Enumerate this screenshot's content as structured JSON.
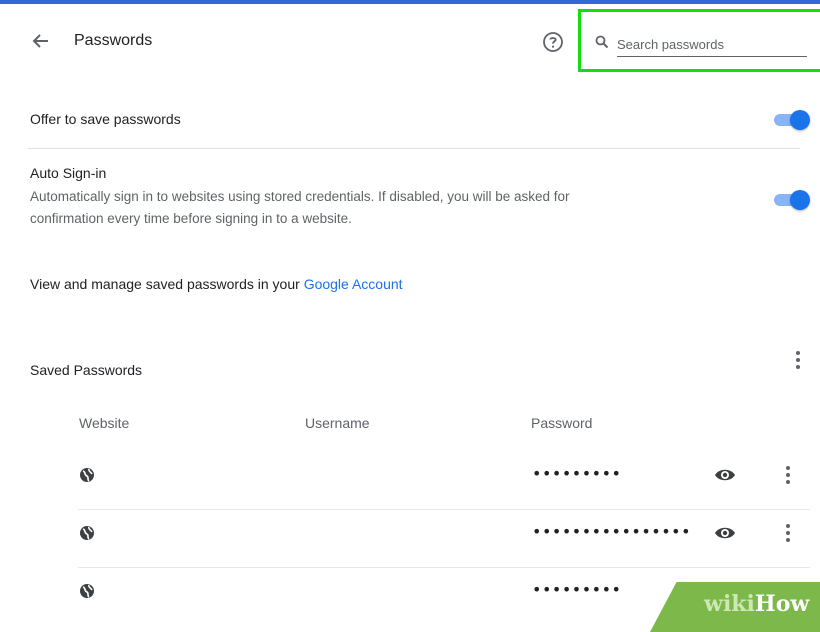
{
  "header": {
    "title": "Passwords",
    "search_placeholder": "Search passwords",
    "search_value": ""
  },
  "settings": {
    "offer_to_save": {
      "label": "Offer to save passwords",
      "enabled": true
    },
    "auto_signin": {
      "label": "Auto Sign-in",
      "description_line1": "Automatically sign in to websites using stored credentials. If disabled, you will be asked for",
      "description_line2": "confirmation every time before signing in to a website.",
      "enabled": true
    },
    "manage_text": "View and manage saved passwords in your ",
    "manage_link": "Google Account"
  },
  "saved_passwords": {
    "heading": "Saved Passwords",
    "columns": [
      "Website",
      "Username",
      "Password"
    ],
    "rows": [
      {
        "website": "",
        "username": "",
        "password_mask": "•••••••••"
      },
      {
        "website": "",
        "username": "",
        "password_mask": "••••••••••••••••"
      },
      {
        "website": "",
        "username": "",
        "password_mask": "•••••••••"
      }
    ]
  },
  "watermark": {
    "wiki": "wiki",
    "how": "How"
  },
  "colors": {
    "accent": "#1a73e8",
    "highlight": "#15dc0e",
    "top_bar": "#3367d6"
  }
}
